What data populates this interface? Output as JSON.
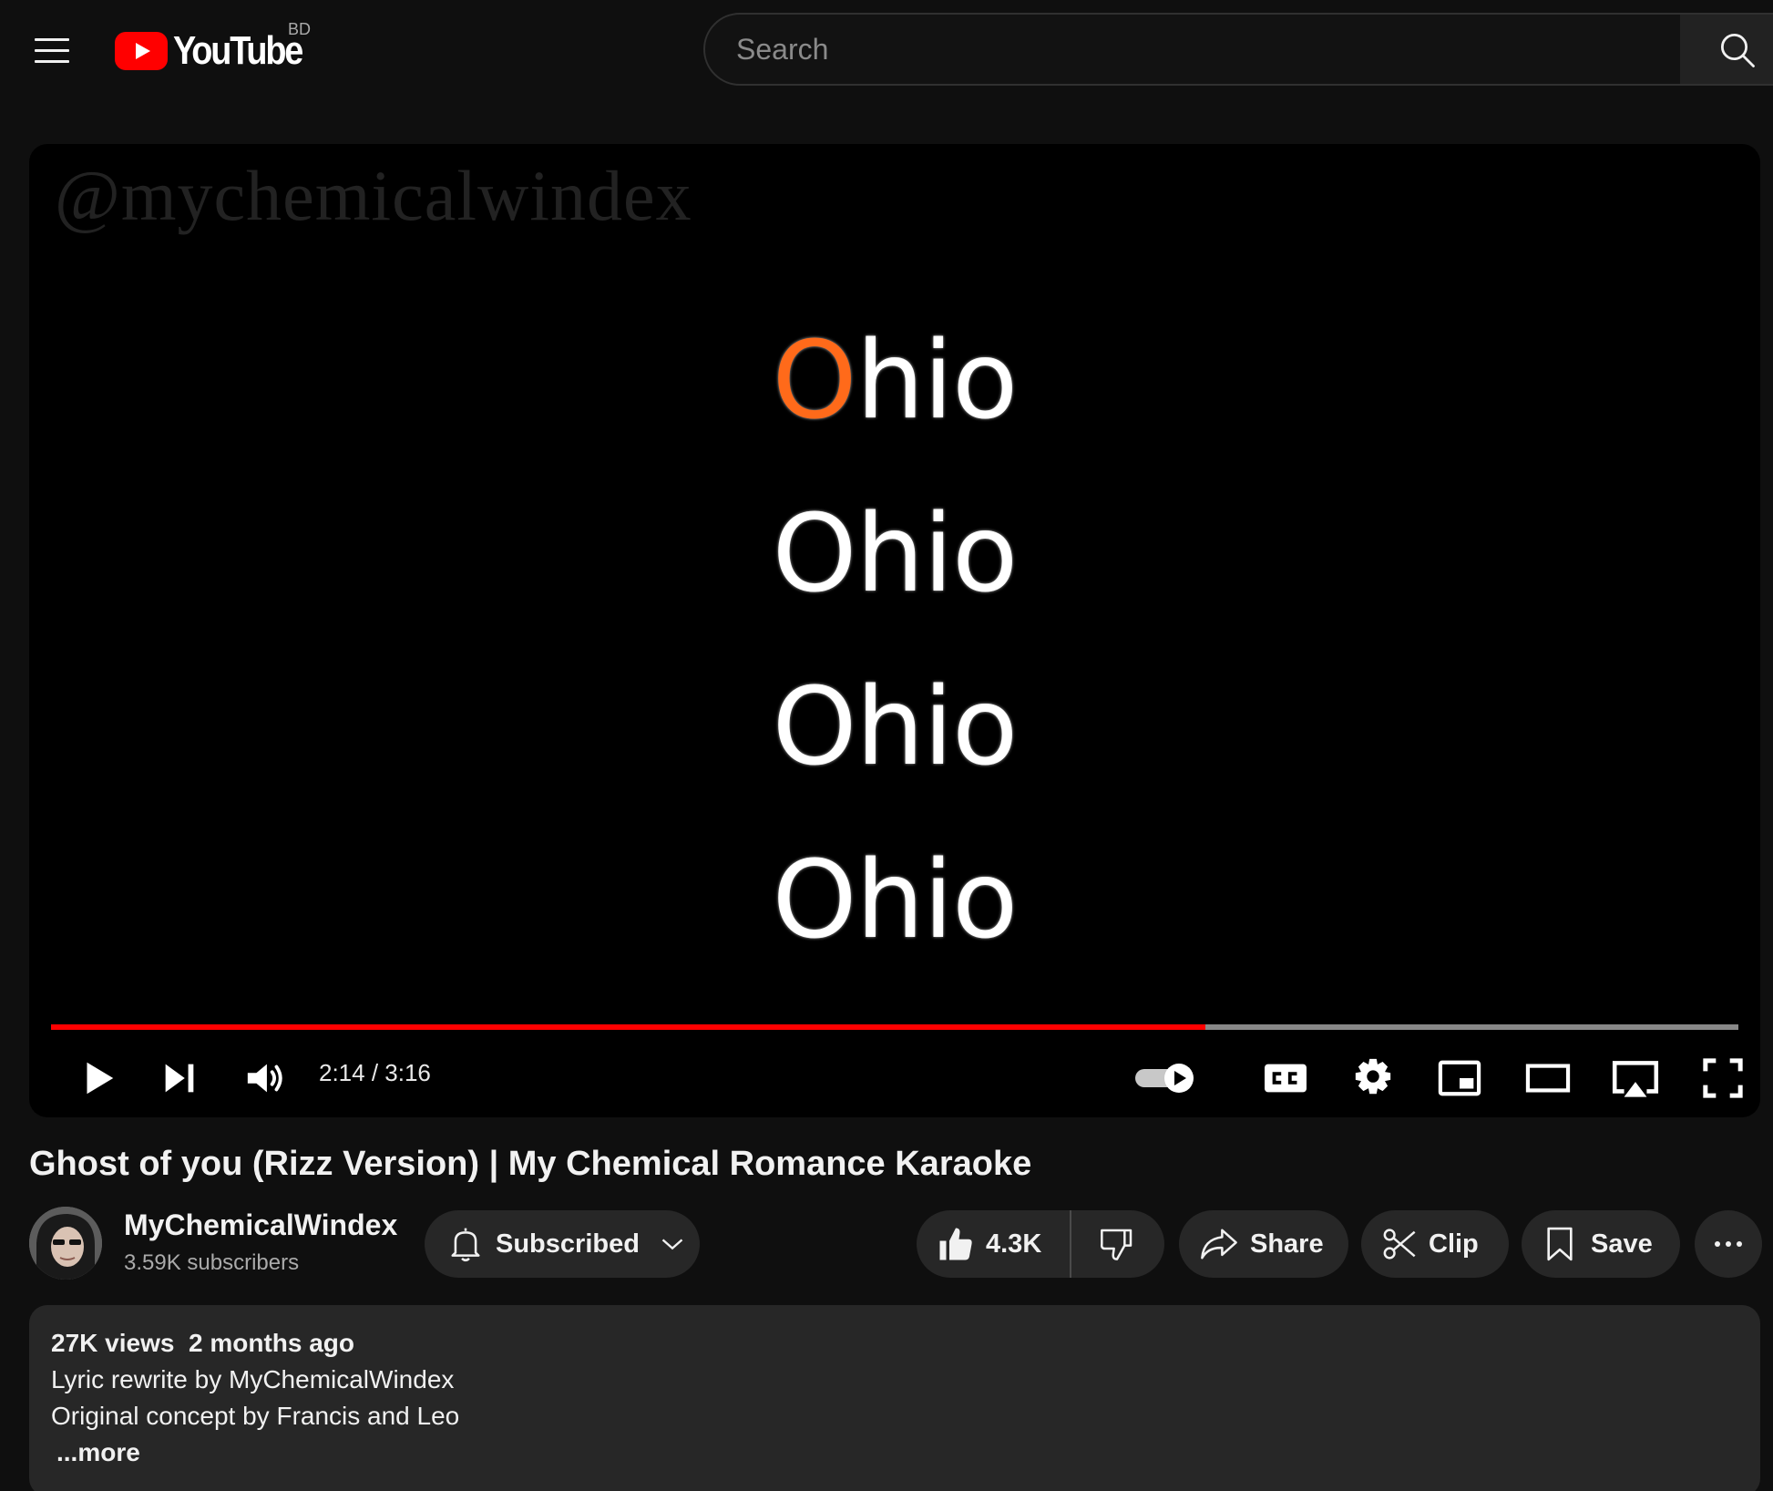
{
  "masthead": {
    "logo_text": "YouTube",
    "country_code": "BD",
    "search_placeholder": "Search",
    "icons": [
      "hamburger-menu-icon",
      "youtube-logo-icon",
      "search-icon"
    ]
  },
  "player": {
    "watermark": "@mychemicalwindex",
    "lyrics": [
      "Ohio",
      "Ohio",
      "Ohio",
      "Ohio"
    ],
    "current_time": "2:14",
    "duration": "3:16",
    "time_display": "2:14 / 3:16",
    "progress_fraction": 0.684,
    "autoplay_on": true,
    "accent_color": "#ff0000",
    "controls": [
      "play-icon",
      "next-icon",
      "volume-icon",
      "autoplay-toggle",
      "captions-icon",
      "settings-icon",
      "miniplayer-icon",
      "theater-mode-icon",
      "airplay-icon",
      "fullscreen-icon"
    ]
  },
  "video": {
    "title": "Ghost of you (Rizz Version) | My Chemical Romance Karaoke",
    "channel_name": "MyChemicalWindex",
    "subscribers": "3.59K subscribers",
    "subscribe_label": "Subscribed",
    "like_count": "4.3K",
    "share_label": "Share",
    "clip_label": "Clip",
    "save_label": "Save"
  },
  "description": {
    "views": "27K views",
    "age": "2 months ago",
    "line1": "Lyric rewrite by MyChemicalWindex",
    "line2": "Original concept by Francis and Leo",
    "more_label": "...more"
  }
}
